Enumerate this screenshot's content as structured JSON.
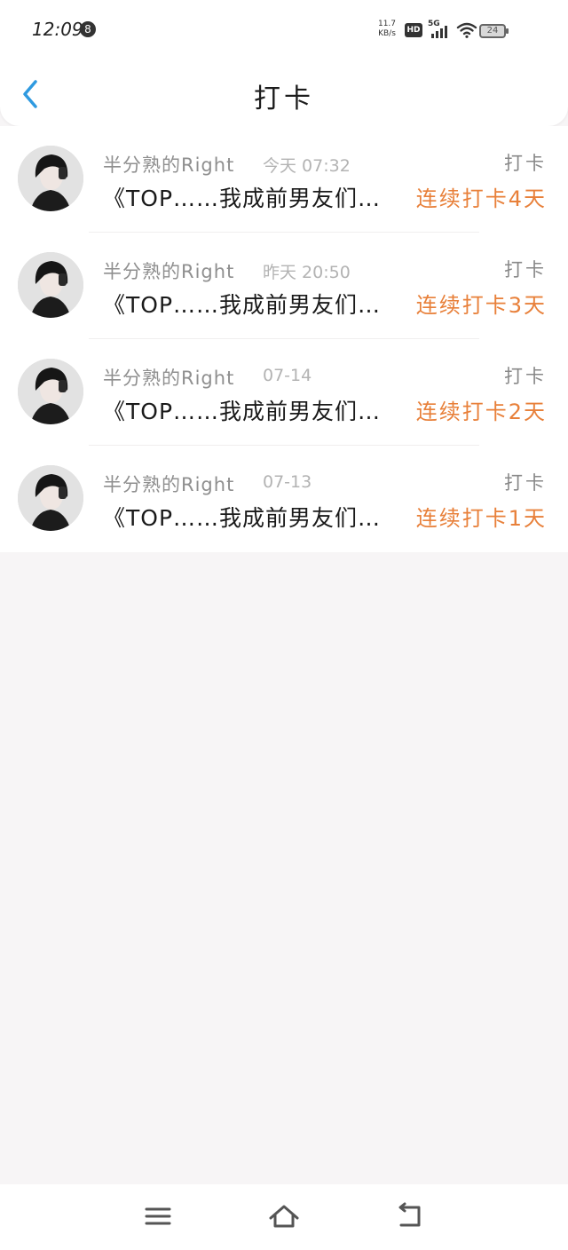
{
  "status_bar": {
    "time": "12:09",
    "notification_count": "8",
    "net_speed_value": "11.7",
    "net_speed_unit": "KB/s",
    "hd_badge": "HD",
    "network": "5G",
    "battery": "24"
  },
  "header": {
    "title": "打卡",
    "back_icon": "chevron-left-icon"
  },
  "colors": {
    "accent_blue": "#2f9ae0",
    "streak_orange": "#e8803a",
    "name_gray": "#8f8f8f",
    "time_gray": "#b3b3b3",
    "background": "#f7f5f6"
  },
  "checkins": [
    {
      "user": "半分熟的Right",
      "time": "今天 07:32",
      "type": "打卡",
      "content": "《TOP……我成前男友们…",
      "streak": "连续打卡4天"
    },
    {
      "user": "半分熟的Right",
      "time": "昨天 20:50",
      "type": "打卡",
      "content": "《TOP……我成前男友们…",
      "streak": "连续打卡3天"
    },
    {
      "user": "半分熟的Right",
      "time": "07-14",
      "type": "打卡",
      "content": "《TOP……我成前男友们…",
      "streak": "连续打卡2天"
    },
    {
      "user": "半分熟的Right",
      "time": "07-13",
      "type": "打卡",
      "content": "《TOP……我成前男友们…",
      "streak": "连续打卡1天"
    }
  ],
  "nav_bar": {
    "menu_icon": "menu-icon",
    "home_icon": "home-icon",
    "back_icon": "return-icon"
  }
}
